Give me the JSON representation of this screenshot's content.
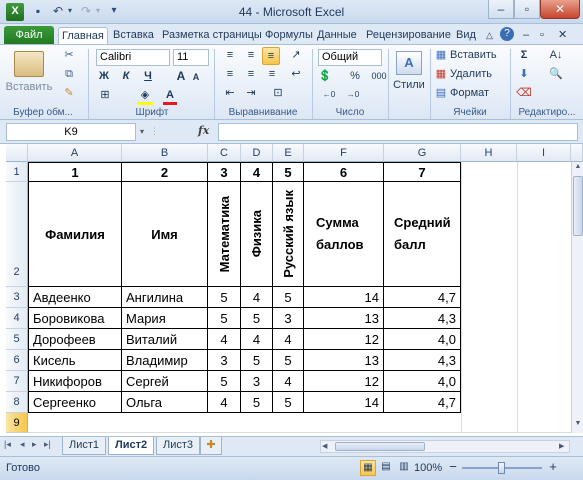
{
  "window": {
    "title": "44  -  Microsoft Excel"
  },
  "tabs": [
    {
      "label": "Файл"
    },
    {
      "label": "Главная"
    },
    {
      "label": "Вставка"
    },
    {
      "label": "Разметка страницы"
    },
    {
      "label": "Формулы"
    },
    {
      "label": "Данные"
    },
    {
      "label": "Рецензирование"
    },
    {
      "label": "Вид"
    }
  ],
  "ribbon": {
    "clipboard": {
      "paste": "Вставить",
      "label": "Буфер обм..."
    },
    "font": {
      "name": "Calibri",
      "size": "11",
      "bold": "Ж",
      "italic": "К",
      "underline": "Ч",
      "grow": "A",
      "shrink": "A",
      "label": "Шрифт"
    },
    "alignment": {
      "label": "Выравнивание"
    },
    "number": {
      "format": "Общий",
      "percent": "%",
      "thousands": "000",
      "label": "Число"
    },
    "styles": {
      "label": "Стили"
    },
    "cells": {
      "insert": "Вставить",
      "delete": "Удалить",
      "format": "Формат",
      "label": "Ячейки"
    },
    "editing": {
      "label": "Редактиро..."
    }
  },
  "formula_bar": {
    "name_box": "K9",
    "fx": "fx",
    "content": ""
  },
  "columns": [
    "A",
    "B",
    "C",
    "D",
    "E",
    "F",
    "G",
    "H",
    "I"
  ],
  "rows": [
    "1",
    "2",
    "3",
    "4",
    "5",
    "6",
    "7",
    "8",
    "9"
  ],
  "header_numbers": [
    "1",
    "2",
    "3",
    "4",
    "5",
    "6",
    "7"
  ],
  "headers": {
    "surname": "Фамилия",
    "name": "Имя",
    "math": "Математика",
    "physics": "Физика",
    "russian": "Русский язык",
    "sum1": "Сумма",
    "sum2": "баллов",
    "avg1": "Средний",
    "avg2": "балл"
  },
  "students": [
    {
      "surname": "Авдеенко",
      "name": "Ангилина",
      "math": "5",
      "physics": "4",
      "russian": "5",
      "sum": "14",
      "avg": "4,7"
    },
    {
      "surname": "Боровикова",
      "name": "Мария",
      "math": "5",
      "physics": "5",
      "russian": "3",
      "sum": "13",
      "avg": "4,3"
    },
    {
      "surname": "Дорофеев",
      "name": "Виталий",
      "math": "4",
      "physics": "4",
      "russian": "4",
      "sum": "12",
      "avg": "4,0"
    },
    {
      "surname": "Кисель",
      "name": "Владимир",
      "math": "3",
      "physics": "5",
      "russian": "5",
      "sum": "13",
      "avg": "4,3"
    },
    {
      "surname": "Никифоров",
      "name": "Сергей",
      "math": "5",
      "physics": "3",
      "russian": "4",
      "sum": "12",
      "avg": "4,0"
    },
    {
      "surname": "Сергеенко",
      "name": "Ольга",
      "math": "4",
      "physics": "5",
      "russian": "5",
      "sum": "14",
      "avg": "4,7"
    }
  ],
  "sheets": [
    {
      "label": "Лист1"
    },
    {
      "label": "Лист2"
    },
    {
      "label": "Лист3"
    }
  ],
  "status": {
    "ready": "Готово",
    "zoom": "100%",
    "minus": "−",
    "plus": "+"
  },
  "colors": {
    "accent": "#217a21",
    "ribbon_bg": "#dfe9f5",
    "highlight": "#f8c54b"
  }
}
